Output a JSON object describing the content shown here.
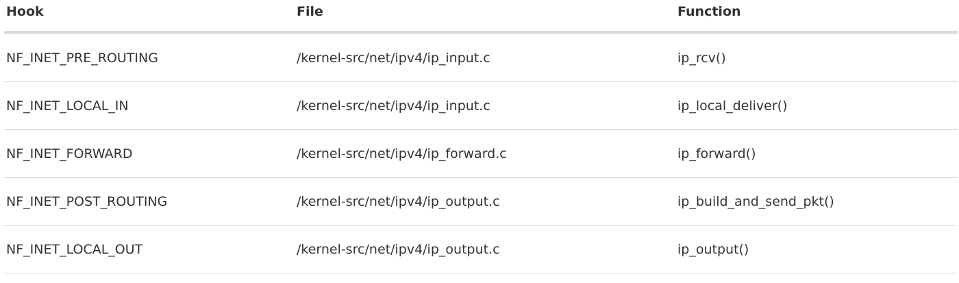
{
  "table": {
    "headers": {
      "hook": "Hook",
      "file": "File",
      "function": "Function"
    },
    "rows": [
      {
        "hook": "NF_INET_PRE_ROUTING",
        "file": "/kernel-src/net/ipv4/ip_input.c",
        "function": "ip_rcv()"
      },
      {
        "hook": "NF_INET_LOCAL_IN",
        "file": "/kernel-src/net/ipv4/ip_input.c",
        "function": "ip_local_deliver()"
      },
      {
        "hook": "NF_INET_FORWARD",
        "file": "/kernel-src/net/ipv4/ip_forward.c",
        "function": "ip_forward()"
      },
      {
        "hook": "NF_INET_POST_ROUTING",
        "file": "/kernel-src/net/ipv4/ip_output.c",
        "function": "ip_build_and_send_pkt()"
      },
      {
        "hook": "NF_INET_LOCAL_OUT",
        "file": "/kernel-src/net/ipv4/ip_output.c",
        "function": "ip_output()"
      }
    ]
  },
  "colors": {
    "text": "#333333",
    "divider": "#dcdcdc",
    "background": "#ffffff"
  }
}
